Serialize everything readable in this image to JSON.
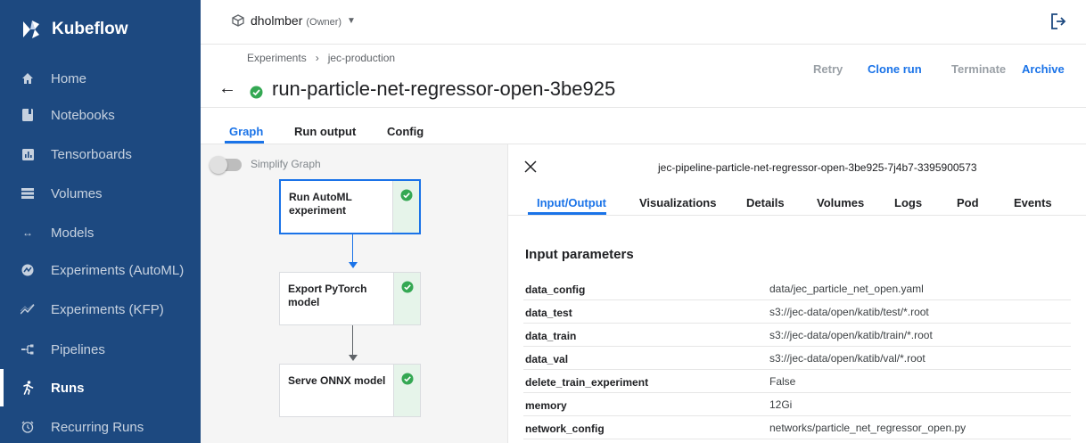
{
  "app": {
    "name": "Kubeflow"
  },
  "sidebar": {
    "items": [
      {
        "label": "Home",
        "icon": "home-icon",
        "active": false
      },
      {
        "label": "Notebooks",
        "icon": "notebook-icon",
        "active": false
      },
      {
        "label": "Tensorboards",
        "icon": "tensorboard-icon",
        "active": false
      },
      {
        "label": "Volumes",
        "icon": "volumes-icon",
        "active": false
      },
      {
        "label": "Models",
        "icon": "models-icon",
        "active": false
      },
      {
        "label": "Experiments (AutoML)",
        "icon": "automl-icon",
        "active": false
      },
      {
        "label": "Experiments (KFP)",
        "icon": "kfp-icon",
        "active": false
      },
      {
        "label": "Pipelines",
        "icon": "pipelines-icon",
        "active": false
      },
      {
        "label": "Runs",
        "icon": "runs-icon",
        "active": true
      },
      {
        "label": "Recurring Runs",
        "icon": "recurring-runs-icon",
        "active": false
      }
    ]
  },
  "topbar": {
    "namespace_user": "dholmber",
    "namespace_role": "(Owner)"
  },
  "breadcrumb": {
    "parent": "Experiments",
    "separator": "›",
    "current": "jec-production"
  },
  "run": {
    "title": "run-particle-net-regressor-open-3be925",
    "status": "succeeded"
  },
  "actions": {
    "retry": "Retry",
    "clone": "Clone run",
    "terminate": "Terminate",
    "archive": "Archive"
  },
  "tabs": {
    "graph": "Graph",
    "run_output": "Run output",
    "config": "Config"
  },
  "graph": {
    "simplify_label": "Simplify Graph",
    "nodes": [
      {
        "label": "Run AutoML experiment",
        "status": "succeeded",
        "selected": true
      },
      {
        "label": "Export PyTorch model",
        "status": "succeeded",
        "selected": false
      },
      {
        "label": "Serve ONNX model",
        "status": "succeeded",
        "selected": false
      }
    ]
  },
  "side_panel": {
    "pod_name": "jec-pipeline-particle-net-regressor-open-3be925-7j4b7-3395900573",
    "tabs": [
      "Input/Output",
      "Visualizations",
      "Details",
      "Volumes",
      "Logs",
      "Pod",
      "Events"
    ],
    "active_tab": "Input/Output",
    "section_title": "Input parameters",
    "params": [
      {
        "key": "data_config",
        "value": "data/jec_particle_net_open.yaml"
      },
      {
        "key": "data_test",
        "value": "s3://jec-data/open/katib/test/*.root"
      },
      {
        "key": "data_train",
        "value": "s3://jec-data/open/katib/train/*.root"
      },
      {
        "key": "data_val",
        "value": "s3://jec-data/open/katib/val/*.root"
      },
      {
        "key": "delete_train_experiment",
        "value": "False"
      },
      {
        "key": "memory",
        "value": "12Gi"
      },
      {
        "key": "network_config",
        "value": "networks/particle_net_regressor_open.py"
      }
    ]
  },
  "colors": {
    "sidebar_bg": "#1d4980",
    "accent": "#1a73e8",
    "success": "#34a853",
    "graph_bg": "#f5f5f5"
  }
}
